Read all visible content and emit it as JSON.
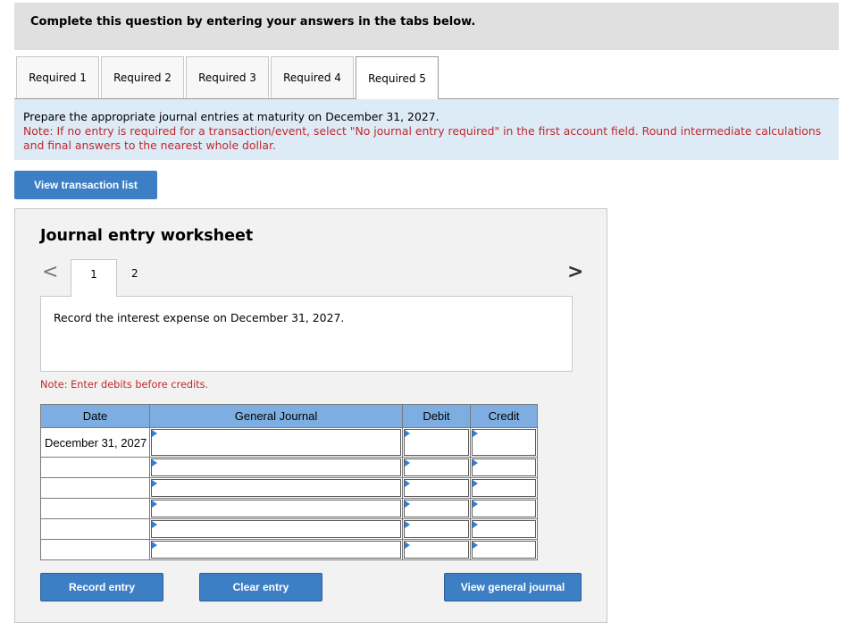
{
  "header": {
    "prompt": "Complete this question by entering your answers in the tabs below."
  },
  "tabs": [
    {
      "label": "Required 1"
    },
    {
      "label": "Required 2"
    },
    {
      "label": "Required 3"
    },
    {
      "label": "Required 4"
    },
    {
      "label": "Required 5"
    }
  ],
  "active_tab": "Required 5",
  "instructions": {
    "main": "Prepare the appropriate journal entries at maturity on December 31, 2027.",
    "note": "Note: If no entry is required for a transaction/event, select \"No journal entry required\" in the first account field. Round intermediate calculations and final answers to the nearest whole dollar."
  },
  "buttons": {
    "view_transactions": "View transaction list",
    "record_entry": "Record entry",
    "clear_entry": "Clear entry",
    "view_general_journal": "View general journal"
  },
  "worksheet": {
    "title": "Journal entry worksheet",
    "pages": [
      "1",
      "2"
    ],
    "active_page": "1",
    "prev_arrow": "<",
    "next_arrow": ">",
    "description": "Record the interest expense on December 31, 2027.",
    "note": "Note: Enter debits before credits."
  },
  "table": {
    "headers": {
      "date": "Date",
      "journal": "General Journal",
      "debit": "Debit",
      "credit": "Credit"
    },
    "rows": [
      {
        "date": "December 31, 2027",
        "journal": "",
        "debit": "",
        "credit": ""
      },
      {
        "date": "",
        "journal": "",
        "debit": "",
        "credit": ""
      },
      {
        "date": "",
        "journal": "",
        "debit": "",
        "credit": ""
      },
      {
        "date": "",
        "journal": "",
        "debit": "",
        "credit": ""
      },
      {
        "date": "",
        "journal": "",
        "debit": "",
        "credit": ""
      },
      {
        "date": "",
        "journal": "",
        "debit": "",
        "credit": ""
      }
    ]
  },
  "colors": {
    "button_blue": "#3d7fc4",
    "header_blue": "#7eaee1",
    "instructions_bg": "#ddebf7",
    "note_red": "#c0282c",
    "input_arrow": "#2f7ed8"
  }
}
